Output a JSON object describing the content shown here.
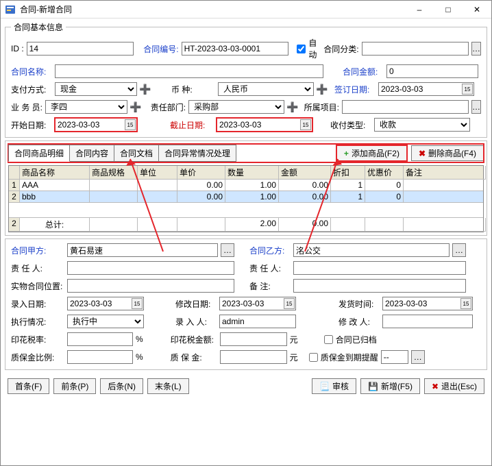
{
  "window": {
    "title": "合同-新增合同"
  },
  "group": {
    "legend": "合同基本信息",
    "id_label": "ID    :",
    "id_value": "14",
    "code_label": "合同编号:",
    "code_value": "HT-2023-03-03-0001",
    "auto_label": "自动",
    "category_label": "合同分类:",
    "name_label": "合同名称:",
    "amount_label": "合同金额:",
    "amount_value": "0",
    "pay_label": "支付方式:",
    "pay_value": "现金",
    "currency_label": "币     种:",
    "currency_value": "人民币",
    "signdate_label": "签订日期:",
    "signdate_value": "2023-03-03",
    "clerk_label": "业 务 员:",
    "clerk_value": "李四",
    "dept_label": "责任部门:",
    "dept_value": "采购部",
    "project_label": "所属项目:",
    "start_label": "开始日期:",
    "start_value": "2023-03-03",
    "end_label": "截止日期:",
    "end_value": "2023-03-03",
    "rptype_label": "收付类型:",
    "rptype_value": "收款"
  },
  "tabs": {
    "t1": "合同商品明细",
    "t2": "合同内容",
    "t3": "合同文档",
    "t4": "合同异常情况处理",
    "add_btn": "添加商品(F2)",
    "del_btn": "删除商品(F4)"
  },
  "grid": {
    "headers": [
      "",
      "商品名称",
      "商品规格",
      "单位",
      "单价",
      "数量",
      "金额",
      "折扣",
      "优惠价",
      "备注"
    ],
    "rows": [
      {
        "rn": "1",
        "name": "AAA",
        "spec": "",
        "unit": "",
        "price": "0.00",
        "qty": "1.00",
        "amount": "0.00",
        "disc": "1",
        "pref": "0",
        "note": ""
      },
      {
        "rn": "2",
        "name": "bbb",
        "spec": "",
        "unit": "",
        "price": "0.00",
        "qty": "1.00",
        "amount": "0.00",
        "disc": "1",
        "pref": "0",
        "note": ""
      }
    ],
    "total_rn": "2",
    "total_label": "总计:",
    "total_qty": "2.00",
    "total_amount": "0.00"
  },
  "lower": {
    "partyA_label": "合同甲方:",
    "partyA_value": "黄石易速",
    "partyB_label": "合同乙方:",
    "partyB_value": "洺公交",
    "respA_label": "责 任 人:",
    "respB_label": "责 任 人:",
    "loc_label": "实物合同位置:",
    "remark_label": "备    注:",
    "entry_label": "录入日期:",
    "entry_value": "2023-03-03",
    "modify_label": "修改日期:",
    "modify_value": "2023-03-03",
    "ship_label": "发货时间:",
    "ship_value": "2023-03-03",
    "status_label": "执行情况:",
    "status_value": "执行中",
    "entryby_label": "录 入 人:",
    "entryby_value": "admin",
    "modifyby_label": "修 改 人:",
    "taxrate_label": "印花税率:",
    "taxrate_suffix": "%",
    "taxamt_label": "印花税金额:",
    "yuan": "元",
    "archived_label": "合同已归档",
    "margin_label": "质保金比例:",
    "margin_suffix": "%",
    "margin_amt_label": "质 保 金:",
    "remind_label": "质保金到期提醒",
    "remind_value": "--"
  },
  "footer": {
    "first": "首条(F)",
    "prev": "前条(P)",
    "next": "后条(N)",
    "last": "末条(L)",
    "audit": "审核",
    "new": "新增(F5)",
    "exit": "退出(Esc)"
  }
}
